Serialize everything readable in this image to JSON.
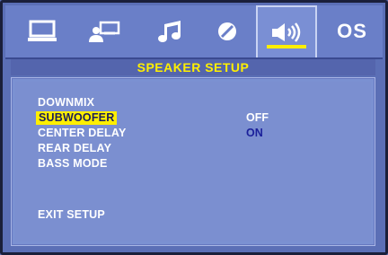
{
  "tabs": [
    {
      "icon": "monitor-icon",
      "active": false
    },
    {
      "icon": "person-screen-icon",
      "active": false
    },
    {
      "icon": "music-note-icon",
      "active": false
    },
    {
      "icon": "disc-slash-icon",
      "active": false
    },
    {
      "icon": "speaker-icon",
      "active": true
    },
    {
      "icon": "os-label",
      "label": "OS",
      "active": false
    }
  ],
  "title": "SPEAKER SETUP",
  "menu": {
    "items": [
      "DOWNMIX",
      "SUBWOOFER",
      "CENTER DELAY",
      "REAR DELAY",
      "BASS MODE"
    ],
    "selected_index": 1,
    "exit": "EXIT SETUP"
  },
  "options": {
    "values": [
      "OFF",
      "ON"
    ],
    "current_index": 1
  },
  "colors": {
    "highlight": "#ffef00",
    "panel": "#7b91d2",
    "topbar": "#6a7fc8",
    "text": "#ffffff",
    "current_option": "#1a1f9a"
  }
}
